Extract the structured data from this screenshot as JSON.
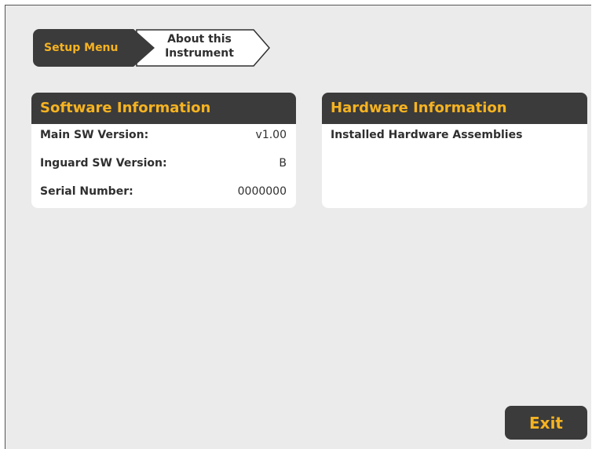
{
  "breadcrumb": {
    "root_label": "Setup Menu",
    "current_label": "About this\nInstrument"
  },
  "software": {
    "title": "Software Information",
    "rows": [
      {
        "label": "Main SW Version:",
        "value": "v1.00"
      },
      {
        "label": "Inguard SW Version:",
        "value": "B"
      },
      {
        "label": "Serial Number:",
        "value": "0000000"
      }
    ]
  },
  "hardware": {
    "title": "Hardware Information",
    "subtitle": "Installed Hardware Assemblies"
  },
  "exit_label": "Exit",
  "colors": {
    "accent": "#f6b321",
    "dark": "#3b3b3b",
    "background": "#ebebeb",
    "panel": "#ffffff"
  }
}
